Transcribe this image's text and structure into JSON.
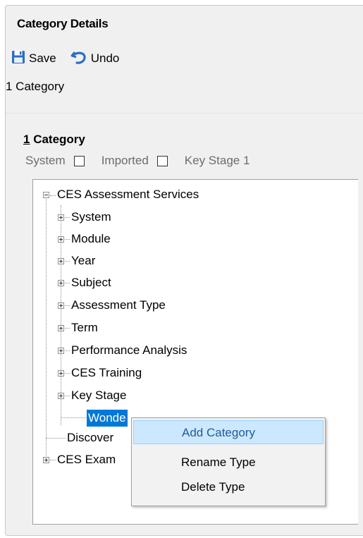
{
  "window": {
    "title": "Category Details"
  },
  "toolbar": {
    "save_label": "Save",
    "undo_label": "Undo",
    "save_icon": "floppy-disk-icon",
    "undo_icon": "undo-arrow-icon"
  },
  "breadcrumb": "1 Category",
  "section": {
    "title_number": "1",
    "title_text": " Category"
  },
  "flags": [
    {
      "label": "System",
      "checked": false
    },
    {
      "label": "Imported",
      "checked": false
    },
    {
      "label": "Key Stage 1",
      "checked": false
    }
  ],
  "tree": {
    "root": "CES Assessment Services",
    "children": [
      "System",
      "Module",
      "Year",
      "Subject",
      "Assessment Type",
      "Term",
      "Performance Analysis",
      "CES Training",
      "Key Stage"
    ],
    "selected_child": "Wonde",
    "siblings": [
      "Discover",
      "CES Exam"
    ]
  },
  "context_menu": {
    "items": [
      {
        "label": "Add Category",
        "highlighted": true
      },
      {
        "label": "Rename Type",
        "highlighted": false
      },
      {
        "label": "Delete Type",
        "highlighted": false
      }
    ]
  },
  "colors": {
    "selection": "#0078d7",
    "menu_highlight": "#cce8ff",
    "menu_highlight_text": "#1f5c99"
  }
}
